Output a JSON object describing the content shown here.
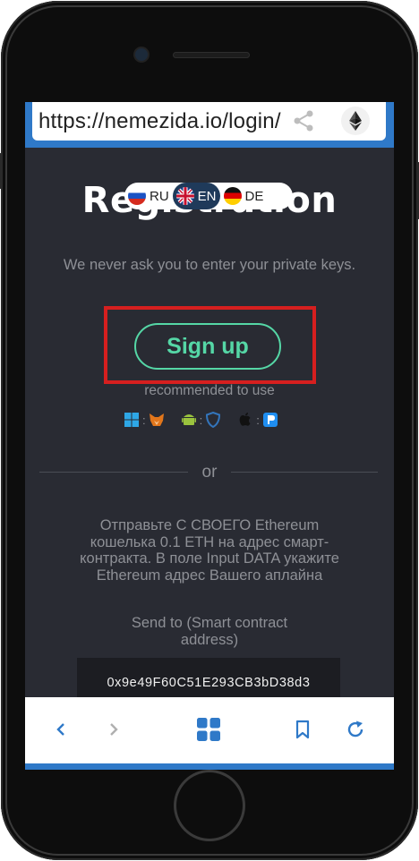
{
  "browser": {
    "url": "https://nemezida.io/login/",
    "share_icon": "share-icon",
    "site_icon": "ethereum-icon"
  },
  "page": {
    "heading": "Registration",
    "languages": [
      {
        "code": "RU",
        "flag": "ru-flag-icon"
      },
      {
        "code": "EN",
        "flag": "uk-flag-icon",
        "active": true
      },
      {
        "code": "DE",
        "flag": "de-flag-icon"
      }
    ],
    "notice": "We never ask you to enter your private keys.",
    "signup_label": "Sign up",
    "recommended": "recommended to use",
    "platforms": [
      [
        "windows-icon",
        "metamask-icon"
      ],
      [
        "android-icon",
        "trust-wallet-icon"
      ],
      [
        "apple-icon",
        "pillar-wallet-icon"
      ]
    ],
    "divider_text": "or",
    "instructions": "Отправьте С СВОЕГО Ethereum кошелька 0.1 ETH на адрес смарт-контракта. В поле Input DATA укажите Ethereum адрес Вашего аплайна",
    "send_to_label": "Send to (Smart contract address)",
    "contract_address": "0x9e49F60C51E293CB3bD38d3"
  },
  "bottom_nav": [
    "back-icon",
    "forward-icon",
    "tabs-grid-icon",
    "bookmark-icon",
    "reload-icon"
  ],
  "colors": {
    "background": "#292b33",
    "accent": "#55d7a6",
    "browser_chrome": "#2f79c8",
    "highlight": "#d61f1f"
  }
}
